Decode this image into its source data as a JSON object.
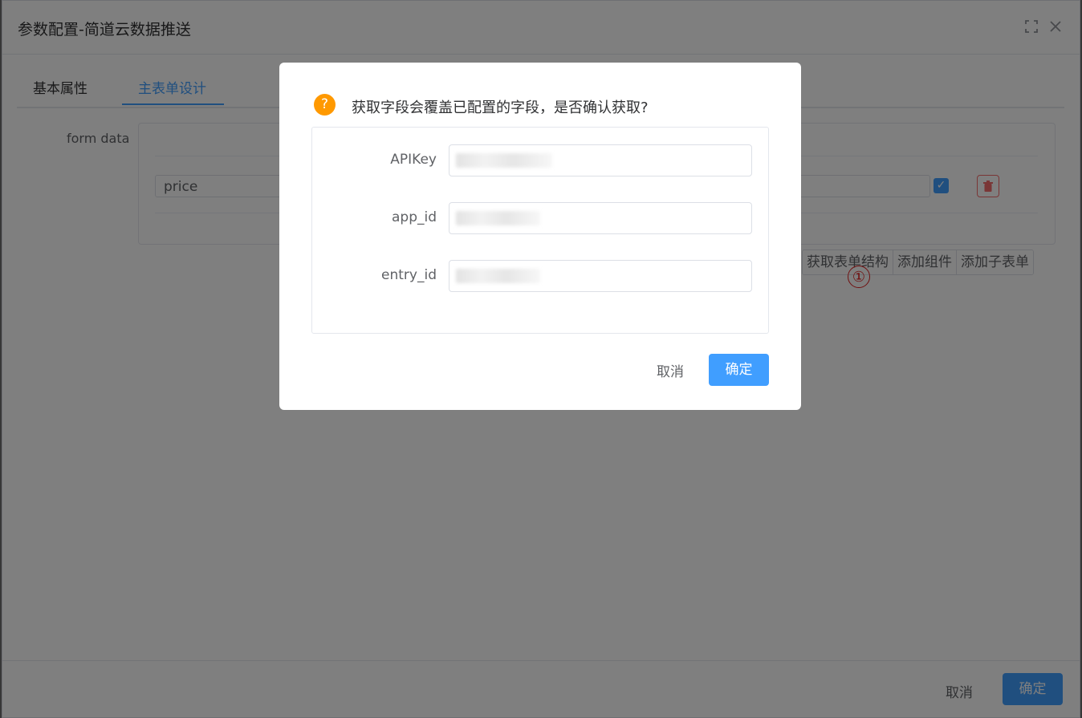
{
  "window": {
    "title": "参数配置-简道云数据推送"
  },
  "tabs": [
    {
      "label": "基本属性",
      "active": false
    },
    {
      "label": "主表单设计",
      "active": true
    }
  ],
  "form": {
    "label": "form data",
    "field_value": "price",
    "checkbox_checked": true
  },
  "toolbar": {
    "get_structure_label": "获取表单结构",
    "add_component_label": "添加组件",
    "add_subform_label": "添加子表单",
    "annotation_mark": "①"
  },
  "footer": {
    "cancel_label": "取消",
    "ok_label": "确定"
  },
  "dialog": {
    "message": "获取字段会覆盖已配置的字段，是否确认获取?",
    "icon": "question-icon",
    "fields": [
      {
        "label": "APIKey",
        "value": ""
      },
      {
        "label": "app_id",
        "value": ""
      },
      {
        "label": "entry_id",
        "value": ""
      }
    ],
    "cancel_label": "取消",
    "ok_label": "确定"
  },
  "colors": {
    "primary": "#409eff",
    "warning": "#ff9900",
    "danger": "#f56c6c",
    "annotation": "#e02020"
  }
}
